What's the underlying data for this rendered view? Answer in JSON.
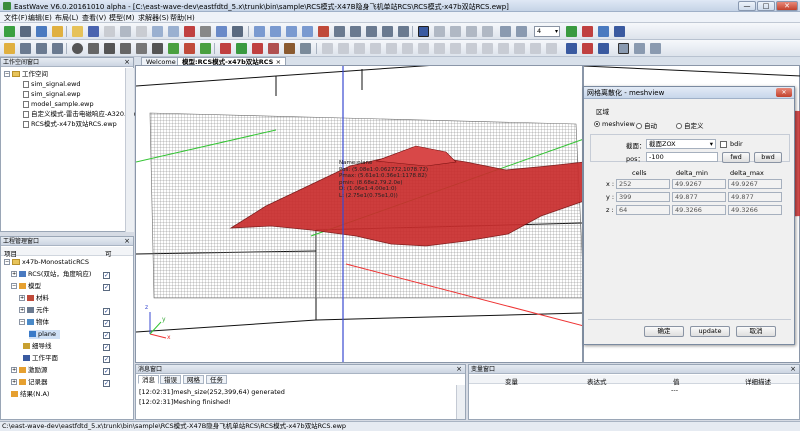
{
  "window": {
    "title": "EastWave V6.0.20161010 alpha - [C:\\east-wave-dev\\eastfdtd_5.x\\trunk\\bin\\sample\\RCS模式-X47B隐身飞机单站RCS\\RCS模式-x47b双站RCS.ewp]",
    "min_label": "—",
    "max_label": "□",
    "close_label": "✕"
  },
  "menu": [
    "文件(F)",
    "编辑(E)",
    "布局(L)",
    "查看(V)",
    "模型(M)",
    "求解器(S)",
    "帮助(H)"
  ],
  "zoom_select_value": "4",
  "workspace": {
    "header": "工作空间窗口",
    "close": "×",
    "root": "工作空间",
    "files": [
      "sim_signal.ewd",
      "sim_signal.ewp",
      "model_sample.ewp",
      "自定义模式-雷击电磁响应-A320.ewp",
      "RCS模式-x47b双站RCS.ewp"
    ]
  },
  "project": {
    "header": "工程管理窗口",
    "close": "×",
    "col_item": "项目",
    "col_vis": "可",
    "root": "x47b-MonostaticRCS",
    "items": [
      {
        "label": "RCS(双站，角度响应)",
        "checked": true
      },
      {
        "label": "模型",
        "checked": true
      },
      {
        "label": "材料",
        "checked": false
      },
      {
        "label": "元件",
        "checked": true
      },
      {
        "label": "物体",
        "checked": true
      },
      {
        "label": "plane",
        "checked": true
      },
      {
        "label": "细导线",
        "checked": true
      },
      {
        "label": "工作平面",
        "checked": true
      },
      {
        "label": "激励源",
        "checked": true
      },
      {
        "label": "记录器",
        "checked": true
      },
      {
        "label": "结果(N.A)",
        "checked": false
      }
    ]
  },
  "doc_tabs": [
    "Welcome",
    "模型:RCS模式-x47b双站RCS"
  ],
  "viewport": {
    "info_lines": [
      "Name:plane",
      "Pos: (5.08e1:0.062772,1078.72)",
      "Pmax: (5.61e1:0.36e1:1178.82)",
      "pmin: (8.68e2,79.2.0e)",
      "D: (1.06e1:4.00e1:0)",
      "L: (2.75e1(0.75e1,0))"
    ],
    "axis_z_label": "z",
    "axis_y_label": "y",
    "axis_x_label": "x"
  },
  "dialog": {
    "title": "网格离散化 - meshview",
    "close": "✕",
    "region_label": "区域",
    "radios": [
      {
        "label": "meshview",
        "on": true
      },
      {
        "label": "自动",
        "on": false
      },
      {
        "label": "自定义",
        "on": false
      }
    ],
    "section_label": "截面：",
    "section_value": "截面ZOX",
    "bdir_label": "bdir",
    "pos_label": "pos：",
    "pos_value": "-100",
    "fwd_label": "fwd",
    "bwd_label": "bwd",
    "cols": [
      "cells",
      "delta_min",
      "delta_max"
    ],
    "rows": [
      {
        "axis": "x :",
        "cells": "252",
        "dmin": "49.9267",
        "dmax": "49.9267"
      },
      {
        "axis": "y :",
        "cells": "399",
        "dmin": "49.877",
        "dmax": "49.877"
      },
      {
        "axis": "z :",
        "cells": "64",
        "dmin": "49.3266",
        "dmax": "49.3266"
      }
    ],
    "ok_label": "确定",
    "update_label": "update",
    "cancel_label": "取消"
  },
  "message": {
    "header": "消息窗口",
    "close": "×",
    "tabs": [
      "消息",
      "错误",
      "网格",
      "任务"
    ],
    "lines": [
      "[12:02:31]mesh_size(252,399,64) generated",
      "[12:02:31]Meshing finished!"
    ]
  },
  "variables": {
    "header": "变量窗口",
    "close": "×",
    "cols": [
      "变量",
      "表达式",
      "值",
      "详细描述"
    ],
    "empty_value": "---"
  },
  "statusbar": "C:\\east-wave-dev\\eastfdtd_5.x\\trunk\\bin\\sample\\RCS模式-X47B隐身飞机单站RCS\\RCS模式-x47b双站RCS.ewp"
}
